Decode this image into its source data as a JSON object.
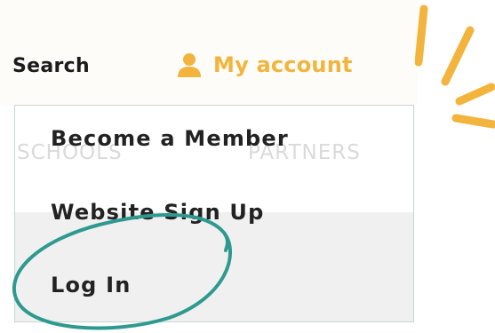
{
  "header": {
    "search_label": "Search",
    "account_label": "My account",
    "account_icon": "user-icon",
    "accent_color": "#f3b43d"
  },
  "background_nav": {
    "schools": "SCHOOLS",
    "partners": "PARTNERS"
  },
  "dropdown": {
    "items": [
      {
        "label": "Become a Member"
      },
      {
        "label": "Website Sign Up"
      },
      {
        "label": "Log In"
      }
    ]
  },
  "annotation": {
    "color": "#2e9a8f",
    "target": "Log In"
  }
}
